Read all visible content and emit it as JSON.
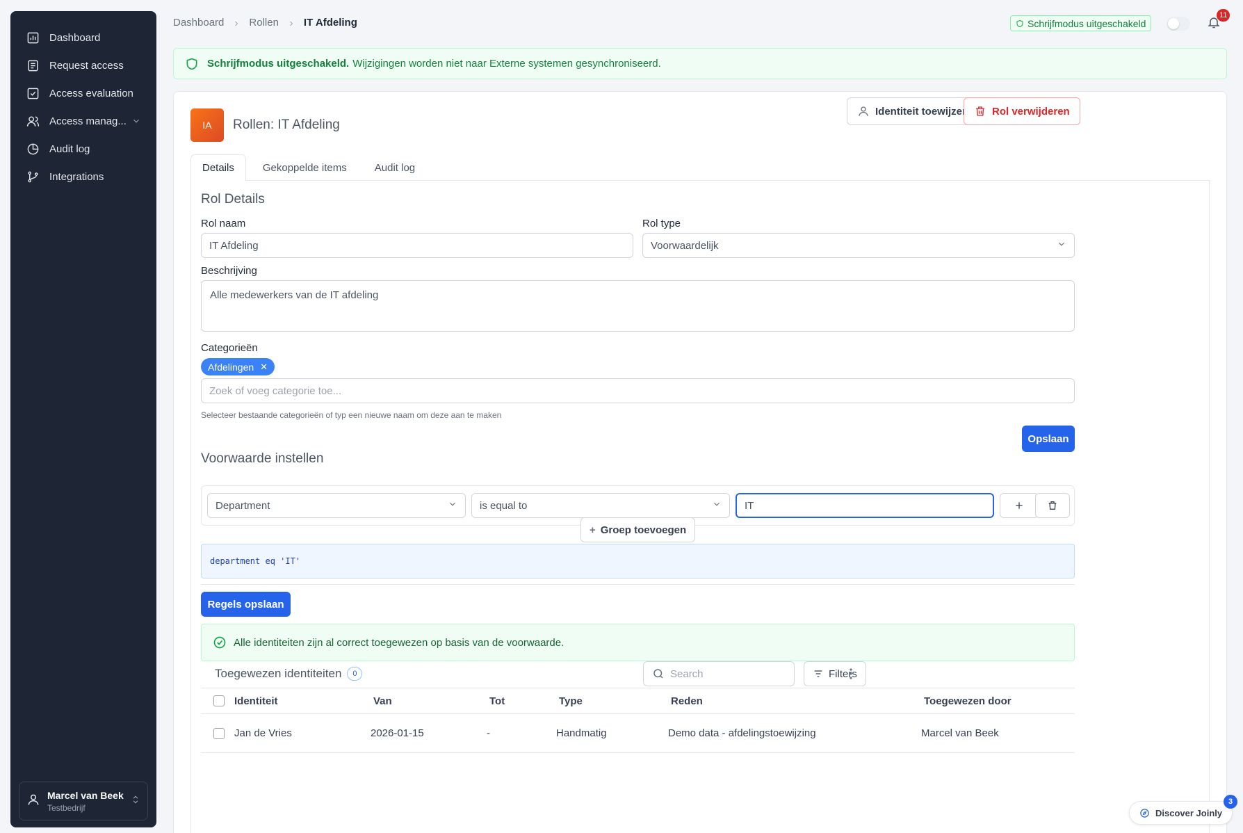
{
  "sidebar": {
    "items": [
      {
        "label": "Dashboard",
        "icon": "bar-chart-icon"
      },
      {
        "label": "Request access",
        "icon": "clipboard-icon"
      },
      {
        "label": "Access evaluation",
        "icon": "check-square-icon"
      },
      {
        "label": "Access manag...",
        "icon": "users-icon"
      },
      {
        "label": "Audit log",
        "icon": "pie-chart-icon"
      },
      {
        "label": "Integrations",
        "icon": "git-branch-icon"
      }
    ],
    "user": {
      "name": "Marcel van Beek",
      "org": "Testbedrijf"
    }
  },
  "breadcrumb": [
    "Dashboard",
    "Rollen",
    "IT Afdeling"
  ],
  "header": {
    "mode_pill": "Schrijfmodus uitgeschakeld",
    "notifications": "11"
  },
  "banner": {
    "bold": "Schrijfmodus uitgeschakeld.",
    "text": "Wijzigingen worden niet naar Externe systemen gesynchroniseerd."
  },
  "role": {
    "initials": "IA",
    "title": "Rollen: IT Afdeling",
    "assign_button": "Identiteit toewijzen",
    "delete_button": "Rol verwijderen"
  },
  "tabs": [
    "Details",
    "Gekoppelde items",
    "Audit log"
  ],
  "details": {
    "section_title": "Rol Details",
    "name_label": "Rol naam",
    "name_value": "IT Afdeling",
    "type_label": "Rol type",
    "type_value": "Voorwaardelijk",
    "desc_label": "Beschrijving",
    "desc_value": "Alle medewerkers van de IT afdeling",
    "cat_label": "Categorieën",
    "cat_chip": "Afdelingen",
    "cat_placeholder": "Zoek of voeg categorie toe...",
    "cat_help": "Selecteer bestaande categorieën of typ een nieuwe naam om deze aan te maken",
    "save_button": "Opslaan"
  },
  "condition": {
    "section_title": "Voorwaarde instellen",
    "field": "Department",
    "operator": "is equal to",
    "value": "IT",
    "add_group": "Groep toevoegen",
    "expression": "department eq 'IT'",
    "save_rules": "Regels opslaan",
    "success": "Alle identiteiten zijn al correct toegewezen op basis van de voorwaarde."
  },
  "assigned": {
    "title": "Toegewezen identiteiten",
    "count": "0",
    "search_placeholder": "Search",
    "filters": "Filters",
    "columns": [
      "Identiteit",
      "Van",
      "Tot",
      "Type",
      "Reden",
      "Toegewezen door"
    ],
    "rows": [
      {
        "identity": "Jan de Vries",
        "from": "2026-01-15",
        "to": "-",
        "type": "Handmatig",
        "reason": "Demo data - afdelingstoewijzing",
        "by": "Marcel van Beek"
      }
    ]
  },
  "discover": {
    "label": "Discover Joinly",
    "badge": "3"
  }
}
